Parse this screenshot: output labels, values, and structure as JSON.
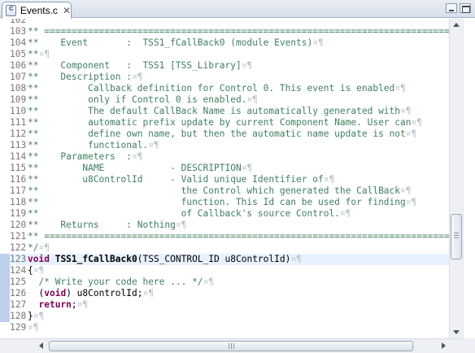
{
  "tab": {
    "title": "Events.c",
    "close_glyph": "✕",
    "icon": "c-source-file-icon"
  },
  "window_controls": {
    "minimize_icon": "minimize-icon",
    "maximize_icon": "maximize-icon"
  },
  "editor": {
    "current_line": 123,
    "lines": [
      {
        "n": "102",
        "parts": [
          [
            "ws",
            "  "
          ]
        ]
      },
      {
        "n": "103",
        "parts": [
          [
            "cmt",
            "** =========================================================================="
          ],
          [
            "ws",
            "¤¶"
          ]
        ]
      },
      {
        "n": "104",
        "parts": [
          [
            "cmt",
            "**    Event       :  TSS1_fCallBack0 (module Events)"
          ],
          [
            "ws",
            "¤¶"
          ]
        ]
      },
      {
        "n": "105",
        "parts": [
          [
            "cmt",
            "**"
          ],
          [
            "ws",
            "¤¶"
          ]
        ]
      },
      {
        "n": "106",
        "parts": [
          [
            "cmt",
            "**    Component   :  TSS1 [TSS_Library]"
          ],
          [
            "ws",
            "¤¶"
          ]
        ]
      },
      {
        "n": "107",
        "parts": [
          [
            "cmt",
            "**    Description :"
          ],
          [
            "ws",
            "¤¶"
          ]
        ]
      },
      {
        "n": "108",
        "parts": [
          [
            "cmt",
            "**         Callback definition for Control 0. This event is enabled"
          ],
          [
            "ws",
            "¤¶"
          ]
        ]
      },
      {
        "n": "109",
        "parts": [
          [
            "cmt",
            "**         only if Control 0 is enabled."
          ],
          [
            "ws",
            "¤¶"
          ]
        ]
      },
      {
        "n": "110",
        "parts": [
          [
            "cmt",
            "**         The default CallBack Name is automatically generated with"
          ],
          [
            "ws",
            "¤¶"
          ]
        ]
      },
      {
        "n": "111",
        "parts": [
          [
            "cmt",
            "**         automatic prefix update by current Component Name. User can"
          ],
          [
            "ws",
            "¤¶"
          ]
        ]
      },
      {
        "n": "112",
        "parts": [
          [
            "cmt",
            "**         define own name, but then the automatic name update is not"
          ],
          [
            "ws",
            "¤¶"
          ]
        ]
      },
      {
        "n": "113",
        "parts": [
          [
            "cmt",
            "**         functional."
          ],
          [
            "ws",
            "¤¶"
          ]
        ]
      },
      {
        "n": "114",
        "parts": [
          [
            "cmt",
            "**    Parameters  :"
          ],
          [
            "ws",
            "¤¶"
          ]
        ]
      },
      {
        "n": "115",
        "parts": [
          [
            "cmt",
            "**        NAME            - DESCRIPTION"
          ],
          [
            "ws",
            "¤¶"
          ]
        ]
      },
      {
        "n": "116",
        "parts": [
          [
            "cmt",
            "**        u8ControlId     - Valid unique Identifier of"
          ],
          [
            "ws",
            "¤¶"
          ]
        ]
      },
      {
        "n": "117",
        "parts": [
          [
            "cmt",
            "**                          the Control which generated the CallBack"
          ],
          [
            "ws",
            "¤¶"
          ]
        ]
      },
      {
        "n": "118",
        "parts": [
          [
            "cmt",
            "**                          function. This Id can be used for finding"
          ],
          [
            "ws",
            "¤¶"
          ]
        ]
      },
      {
        "n": "119",
        "parts": [
          [
            "cmt",
            "**                          of Callback's source Control."
          ],
          [
            "ws",
            "¤¶"
          ]
        ]
      },
      {
        "n": "120",
        "parts": [
          [
            "cmt",
            "**    Returns     : Nothing"
          ],
          [
            "ws",
            "¤¶"
          ]
        ]
      },
      {
        "n": "121",
        "parts": [
          [
            "cmt",
            "** =========================================================================="
          ],
          [
            "ws",
            "¤¶"
          ]
        ]
      },
      {
        "n": "122",
        "parts": [
          [
            "cmt",
            "*/"
          ],
          [
            "ws",
            "¤¶"
          ]
        ]
      },
      {
        "n": "123",
        "parts": [
          [
            "kw",
            "void"
          ],
          [
            "plain",
            " "
          ],
          [
            "fn",
            "TSS1_fCallBack0"
          ],
          [
            "plain",
            "(TSS_CONTROL_ID u8ControlId)"
          ],
          [
            "ws",
            "¤¶"
          ]
        ]
      },
      {
        "n": "124",
        "parts": [
          [
            "plain",
            "{"
          ],
          [
            "ws",
            "¤¶"
          ]
        ]
      },
      {
        "n": "125",
        "parts": [
          [
            "ws",
            "  "
          ],
          [
            "cmt",
            "/* Write your code here ... */"
          ],
          [
            "ws",
            "¤¶"
          ]
        ]
      },
      {
        "n": "126",
        "parts": [
          [
            "ws",
            "  "
          ],
          [
            "plain",
            "("
          ],
          [
            "kw",
            "void"
          ],
          [
            "plain",
            ") u8ControlId;"
          ],
          [
            "ws",
            "¤¶"
          ]
        ]
      },
      {
        "n": "127",
        "parts": [
          [
            "ws",
            "  "
          ],
          [
            "kw",
            "return"
          ],
          [
            "plain",
            ";"
          ],
          [
            "ws",
            "¤¶"
          ]
        ]
      },
      {
        "n": "128",
        "parts": [
          [
            "plain",
            "}"
          ],
          [
            "ws",
            "¤¶"
          ]
        ]
      },
      {
        "n": "129",
        "parts": [
          [
            "ws",
            "¤¶"
          ]
        ]
      }
    ]
  },
  "scrollbars": {
    "h_grip": "⦙⦙⦙",
    "up_icon": "arrow-up-icon",
    "down_icon": "arrow-down-icon"
  }
}
